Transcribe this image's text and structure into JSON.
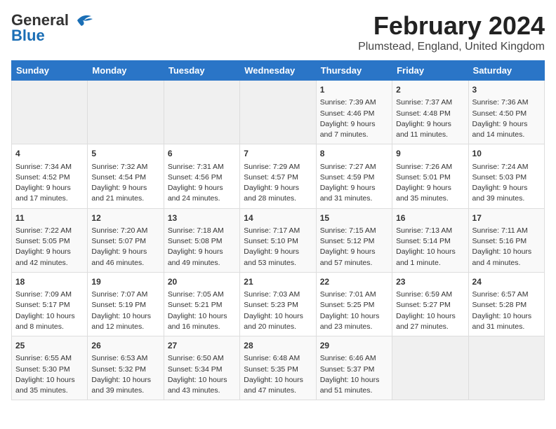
{
  "header": {
    "logo_general": "General",
    "logo_blue": "Blue",
    "month_title": "February 2024",
    "location": "Plumstead, England, United Kingdom"
  },
  "weekdays": [
    "Sunday",
    "Monday",
    "Tuesday",
    "Wednesday",
    "Thursday",
    "Friday",
    "Saturday"
  ],
  "weeks": [
    [
      {
        "day": "",
        "info": ""
      },
      {
        "day": "",
        "info": ""
      },
      {
        "day": "",
        "info": ""
      },
      {
        "day": "",
        "info": ""
      },
      {
        "day": "1",
        "info": "Sunrise: 7:39 AM\nSunset: 4:46 PM\nDaylight: 9 hours and 7 minutes."
      },
      {
        "day": "2",
        "info": "Sunrise: 7:37 AM\nSunset: 4:48 PM\nDaylight: 9 hours and 11 minutes."
      },
      {
        "day": "3",
        "info": "Sunrise: 7:36 AM\nSunset: 4:50 PM\nDaylight: 9 hours and 14 minutes."
      }
    ],
    [
      {
        "day": "4",
        "info": "Sunrise: 7:34 AM\nSunset: 4:52 PM\nDaylight: 9 hours and 17 minutes."
      },
      {
        "day": "5",
        "info": "Sunrise: 7:32 AM\nSunset: 4:54 PM\nDaylight: 9 hours and 21 minutes."
      },
      {
        "day": "6",
        "info": "Sunrise: 7:31 AM\nSunset: 4:56 PM\nDaylight: 9 hours and 24 minutes."
      },
      {
        "day": "7",
        "info": "Sunrise: 7:29 AM\nSunset: 4:57 PM\nDaylight: 9 hours and 28 minutes."
      },
      {
        "day": "8",
        "info": "Sunrise: 7:27 AM\nSunset: 4:59 PM\nDaylight: 9 hours and 31 minutes."
      },
      {
        "day": "9",
        "info": "Sunrise: 7:26 AM\nSunset: 5:01 PM\nDaylight: 9 hours and 35 minutes."
      },
      {
        "day": "10",
        "info": "Sunrise: 7:24 AM\nSunset: 5:03 PM\nDaylight: 9 hours and 39 minutes."
      }
    ],
    [
      {
        "day": "11",
        "info": "Sunrise: 7:22 AM\nSunset: 5:05 PM\nDaylight: 9 hours and 42 minutes."
      },
      {
        "day": "12",
        "info": "Sunrise: 7:20 AM\nSunset: 5:07 PM\nDaylight: 9 hours and 46 minutes."
      },
      {
        "day": "13",
        "info": "Sunrise: 7:18 AM\nSunset: 5:08 PM\nDaylight: 9 hours and 49 minutes."
      },
      {
        "day": "14",
        "info": "Sunrise: 7:17 AM\nSunset: 5:10 PM\nDaylight: 9 hours and 53 minutes."
      },
      {
        "day": "15",
        "info": "Sunrise: 7:15 AM\nSunset: 5:12 PM\nDaylight: 9 hours and 57 minutes."
      },
      {
        "day": "16",
        "info": "Sunrise: 7:13 AM\nSunset: 5:14 PM\nDaylight: 10 hours and 1 minute."
      },
      {
        "day": "17",
        "info": "Sunrise: 7:11 AM\nSunset: 5:16 PM\nDaylight: 10 hours and 4 minutes."
      }
    ],
    [
      {
        "day": "18",
        "info": "Sunrise: 7:09 AM\nSunset: 5:17 PM\nDaylight: 10 hours and 8 minutes."
      },
      {
        "day": "19",
        "info": "Sunrise: 7:07 AM\nSunset: 5:19 PM\nDaylight: 10 hours and 12 minutes."
      },
      {
        "day": "20",
        "info": "Sunrise: 7:05 AM\nSunset: 5:21 PM\nDaylight: 10 hours and 16 minutes."
      },
      {
        "day": "21",
        "info": "Sunrise: 7:03 AM\nSunset: 5:23 PM\nDaylight: 10 hours and 20 minutes."
      },
      {
        "day": "22",
        "info": "Sunrise: 7:01 AM\nSunset: 5:25 PM\nDaylight: 10 hours and 23 minutes."
      },
      {
        "day": "23",
        "info": "Sunrise: 6:59 AM\nSunset: 5:27 PM\nDaylight: 10 hours and 27 minutes."
      },
      {
        "day": "24",
        "info": "Sunrise: 6:57 AM\nSunset: 5:28 PM\nDaylight: 10 hours and 31 minutes."
      }
    ],
    [
      {
        "day": "25",
        "info": "Sunrise: 6:55 AM\nSunset: 5:30 PM\nDaylight: 10 hours and 35 minutes."
      },
      {
        "day": "26",
        "info": "Sunrise: 6:53 AM\nSunset: 5:32 PM\nDaylight: 10 hours and 39 minutes."
      },
      {
        "day": "27",
        "info": "Sunrise: 6:50 AM\nSunset: 5:34 PM\nDaylight: 10 hours and 43 minutes."
      },
      {
        "day": "28",
        "info": "Sunrise: 6:48 AM\nSunset: 5:35 PM\nDaylight: 10 hours and 47 minutes."
      },
      {
        "day": "29",
        "info": "Sunrise: 6:46 AM\nSunset: 5:37 PM\nDaylight: 10 hours and 51 minutes."
      },
      {
        "day": "",
        "info": ""
      },
      {
        "day": "",
        "info": ""
      }
    ]
  ]
}
